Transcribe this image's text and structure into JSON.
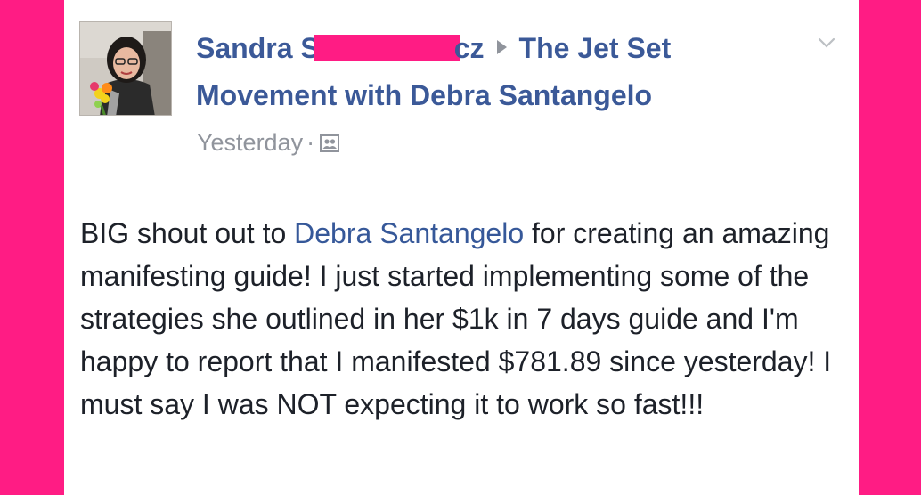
{
  "post": {
    "author_first": "Sandra",
    "author_tail": "cz",
    "group_line1": "The Jet Set",
    "group_line2": "Movement with Debra Santangelo",
    "timestamp": "Yesterday",
    "separator": "·",
    "body_part1": "BIG shout out to ",
    "mention": "Debra Santangelo",
    "body_part2": " for creating an amazing manifesting guide! I just started implementing some of the strategies she outlined in her $1k in 7 days guide and I'm happy to report that I manifested $781.89 since yesterday! I must say I was NOT expecting it to work so fast!!!"
  },
  "icons": {
    "audience": "group-audience-icon",
    "options": "chevron-down-icon",
    "arrow": "triangle-right-icon"
  },
  "colors": {
    "background": "#ff1c84",
    "link": "#3b5998",
    "meta": "#90949c",
    "text": "#1d2129"
  }
}
